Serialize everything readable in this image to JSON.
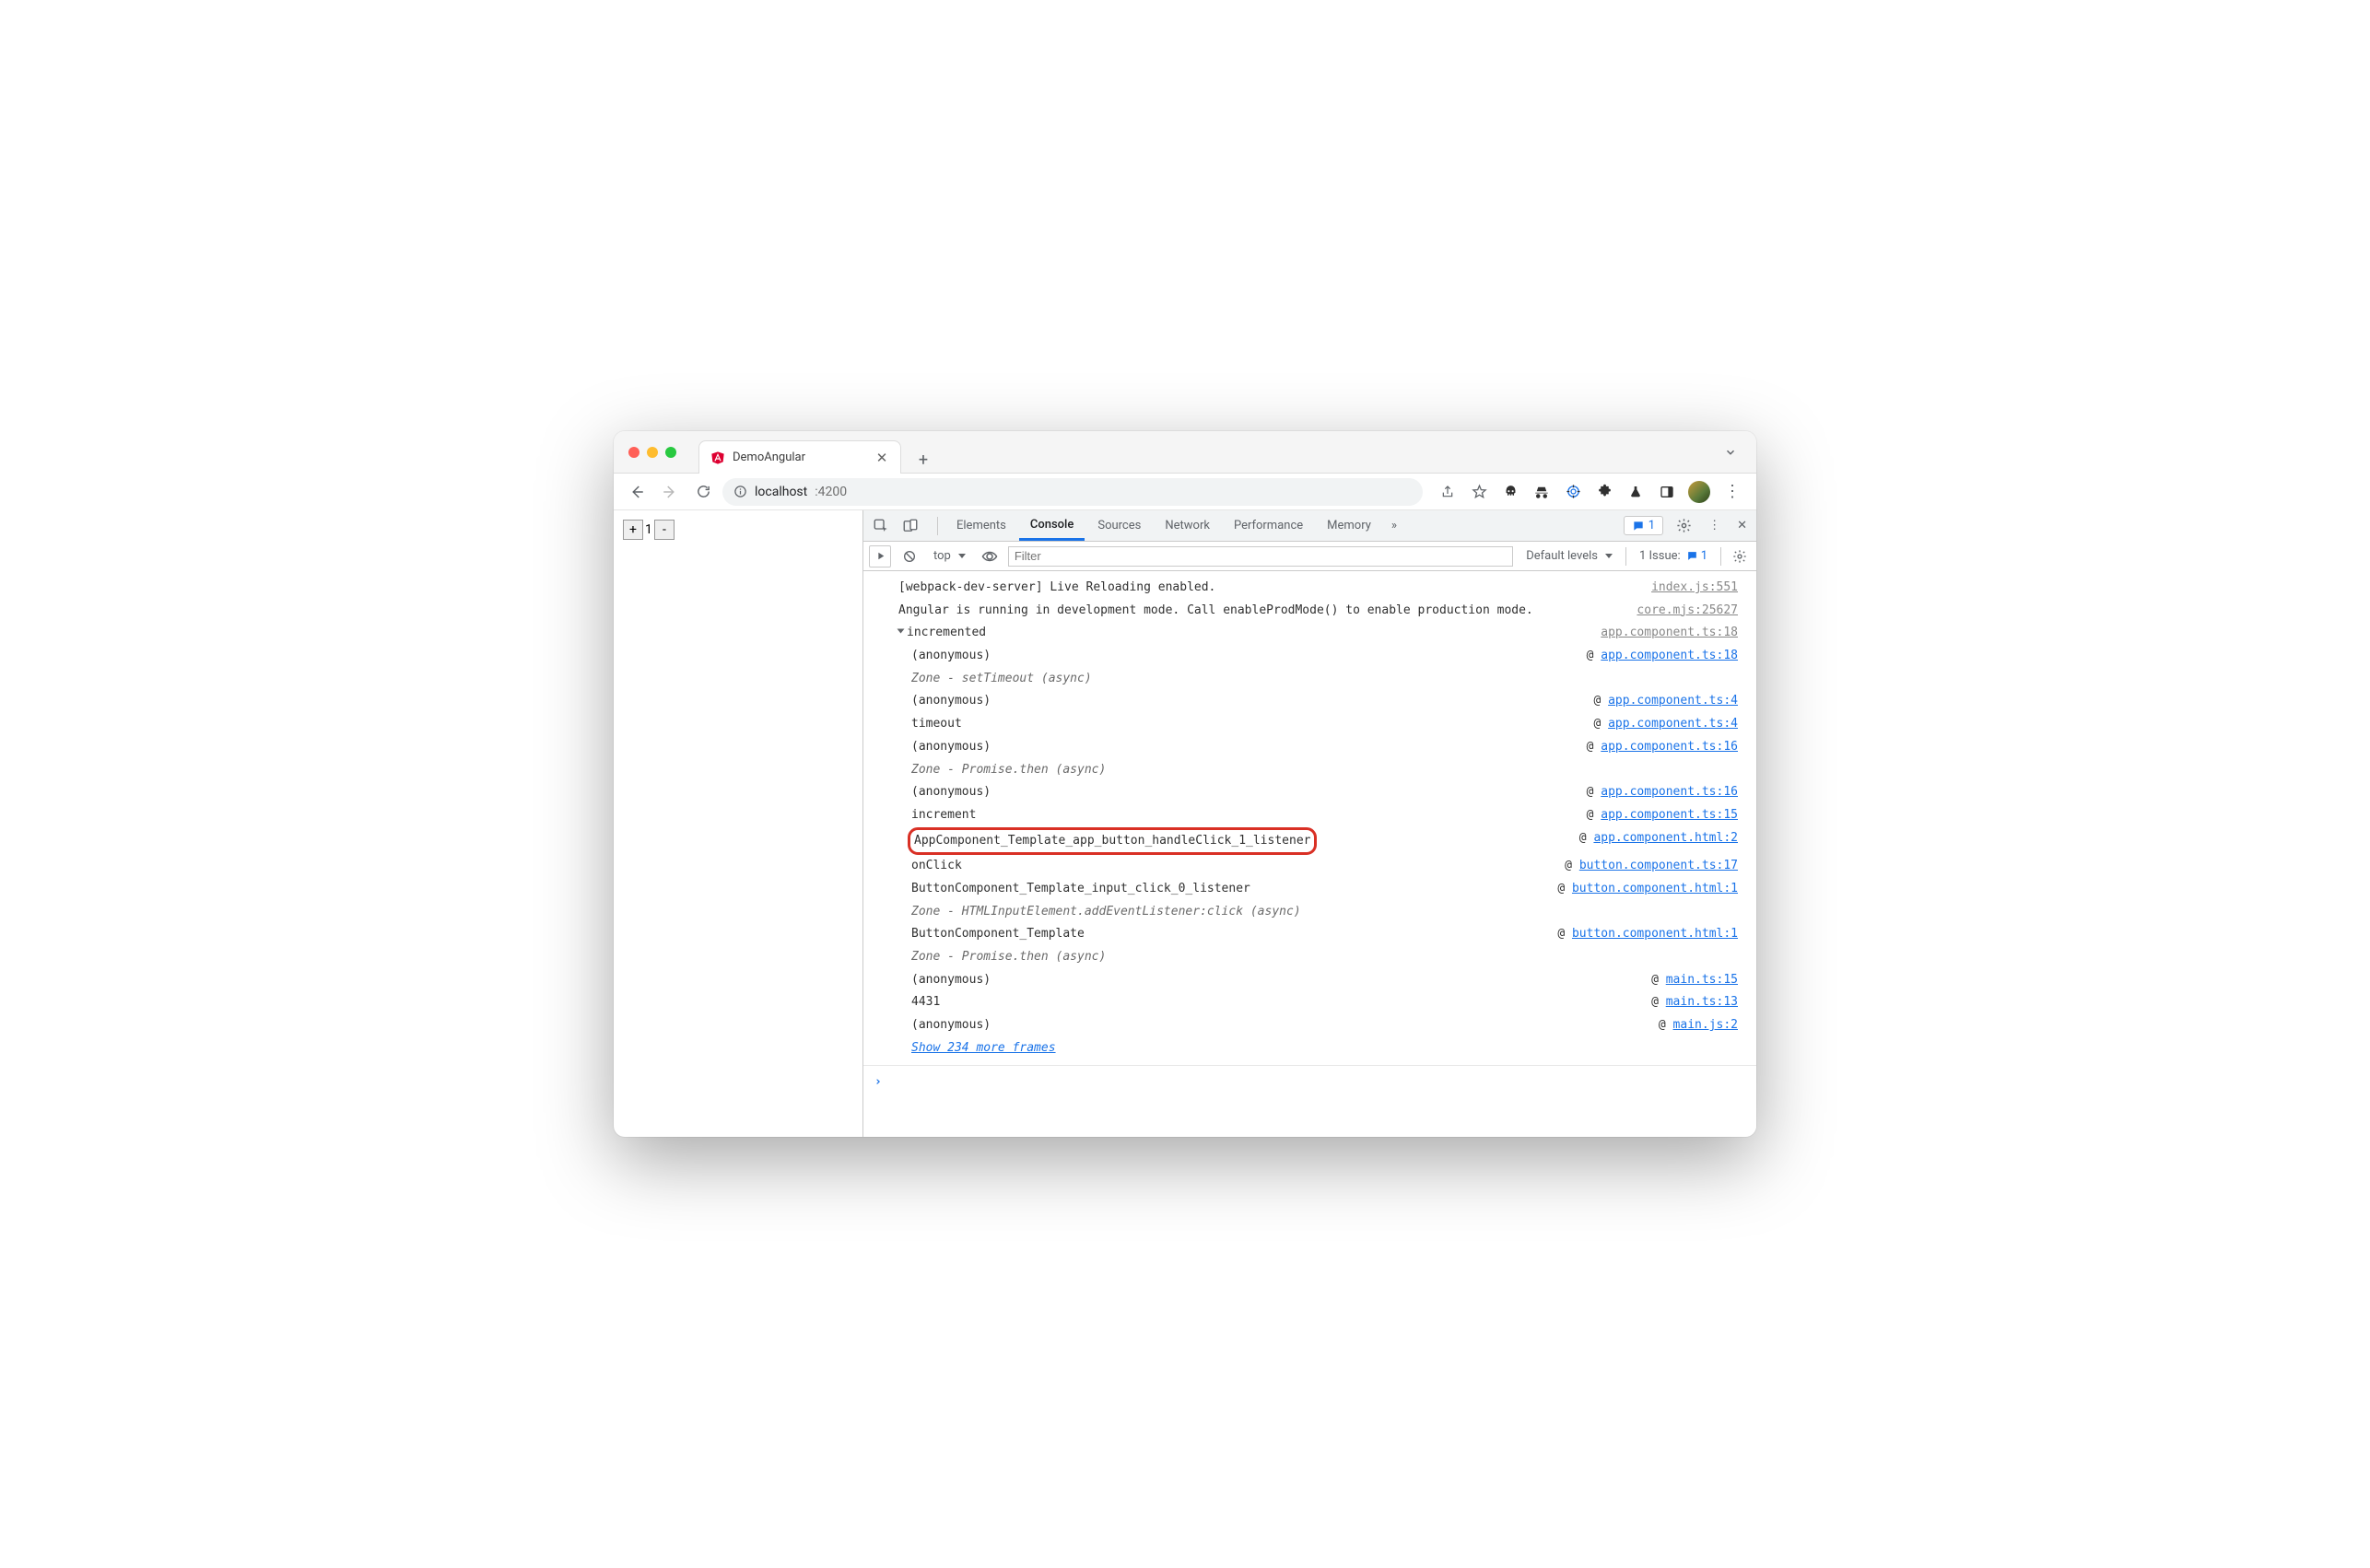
{
  "tab": {
    "title": "DemoAngular"
  },
  "url": {
    "domain": "localhost",
    "path": ":4200"
  },
  "page": {
    "counter": "1"
  },
  "devtools": {
    "tabs": [
      "Elements",
      "Console",
      "Sources",
      "Network",
      "Performance",
      "Memory"
    ],
    "active": "Console",
    "badge_count": "1",
    "subbar": {
      "context": "top",
      "filter_placeholder": "Filter",
      "levels": "Default levels",
      "issues_label": "1 Issue:",
      "issues_count": "1"
    }
  },
  "console": {
    "msg1": {
      "text": "[webpack-dev-server] Live Reloading enabled.",
      "src": "index.js:551"
    },
    "msg2": {
      "text": "Angular is running in development mode. Call enableProdMode() to enable production mode.",
      "src": "core.mjs:25627"
    },
    "trace_head": "incremented",
    "trace_head_src": "app.component.ts:18",
    "frames": [
      {
        "name": "(anonymous)",
        "at": "@",
        "loc": "app.component.ts:18",
        "link": true
      },
      {
        "name": "Zone - setTimeout (async)",
        "italic": true
      },
      {
        "name": "(anonymous)",
        "at": "@",
        "loc": "app.component.ts:4",
        "link": true
      },
      {
        "name": "timeout",
        "at": "@",
        "loc": "app.component.ts:4",
        "link": true
      },
      {
        "name": "(anonymous)",
        "at": "@",
        "loc": "app.component.ts:16",
        "link": true
      },
      {
        "name": "Zone - Promise.then (async)",
        "italic": true
      },
      {
        "name": "(anonymous)",
        "at": "@",
        "loc": "app.component.ts:16",
        "link": true
      },
      {
        "name": "increment",
        "at": "@",
        "loc": "app.component.ts:15",
        "link": true
      },
      {
        "name": "AppComponent_Template_app_button_handleClick_1_listener",
        "at": "@",
        "loc": "app.component.html:2",
        "link": true,
        "highlight": true
      },
      {
        "name": "onClick",
        "at": "@",
        "loc": "button.component.ts:17",
        "link": true
      },
      {
        "name": "ButtonComponent_Template_input_click_0_listener",
        "at": "@",
        "loc": "button.component.html:1",
        "link": true
      },
      {
        "name": "Zone - HTMLInputElement.addEventListener:click (async)",
        "italic": true
      },
      {
        "name": "ButtonComponent_Template",
        "at": "@",
        "loc": "button.component.html:1",
        "link": true
      },
      {
        "name": "Zone - Promise.then (async)",
        "italic": true
      },
      {
        "name": "(anonymous)",
        "at": "@",
        "loc": "main.ts:15",
        "link": true
      },
      {
        "name": "4431",
        "at": "@",
        "loc": "main.ts:13",
        "link": true
      },
      {
        "name": "(anonymous)",
        "at": "@",
        "loc": "main.js:2",
        "link": true
      }
    ],
    "show_more": "Show 234 more frames"
  }
}
